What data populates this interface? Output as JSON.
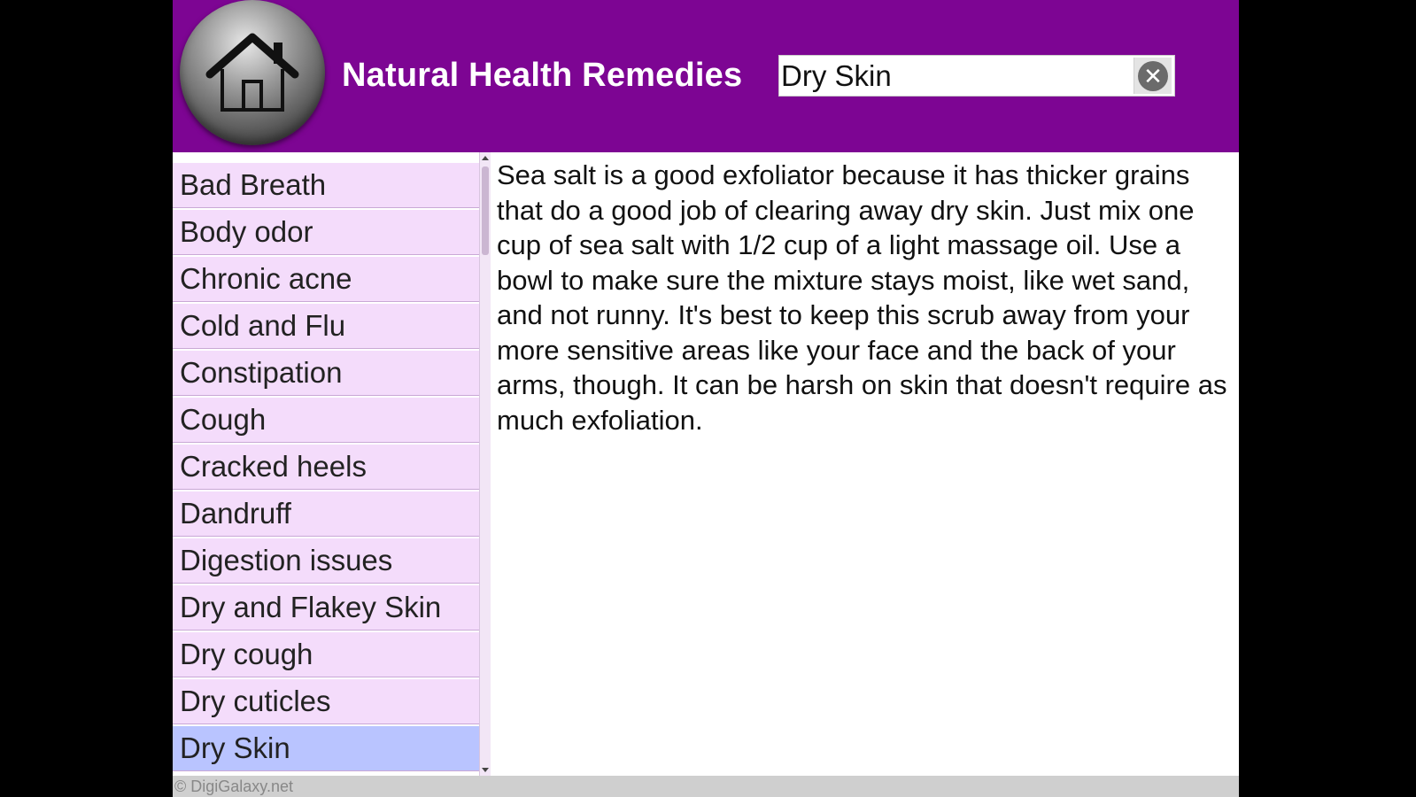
{
  "header": {
    "home_icon": "home-icon",
    "title": "Natural Health Remedies",
    "background_color": "#7d0593"
  },
  "search": {
    "value": "Dry Skin",
    "placeholder": "",
    "clear_icon": "clear-icon",
    "clear_glyph": "✕"
  },
  "sidebar": {
    "items": [
      {
        "label": "Bad Breath",
        "selected": false
      },
      {
        "label": "Body odor",
        "selected": false
      },
      {
        "label": "Chronic acne",
        "selected": false
      },
      {
        "label": "Cold and Flu",
        "selected": false
      },
      {
        "label": "Constipation",
        "selected": false
      },
      {
        "label": "Cough",
        "selected": false
      },
      {
        "label": "Cracked heels",
        "selected": false
      },
      {
        "label": "Dandruff",
        "selected": false
      },
      {
        "label": "Digestion issues",
        "selected": false
      },
      {
        "label": "Dry and Flakey Skin",
        "selected": false
      },
      {
        "label": "Dry cough",
        "selected": false
      },
      {
        "label": "Dry cuticles",
        "selected": false
      },
      {
        "label": "Dry Skin",
        "selected": true
      }
    ],
    "item_color": "#f4dcfb",
    "selected_color": "#b9c4ff"
  },
  "content": {
    "text": "Sea salt is a good exfoliator because it has thicker grains that do a good job of clearing away dry skin. Just mix one cup of sea salt with 1/2 cup of a light massage oil. Use a bowl to make sure the mixture stays moist, like wet sand, and not runny. It's best to keep this scrub away from your more sensitive areas like your face and the back of your arms, though. It can be harsh on skin that doesn't require as much exfoliation."
  },
  "footer": {
    "copyright": "© DigiGalaxy.net"
  }
}
